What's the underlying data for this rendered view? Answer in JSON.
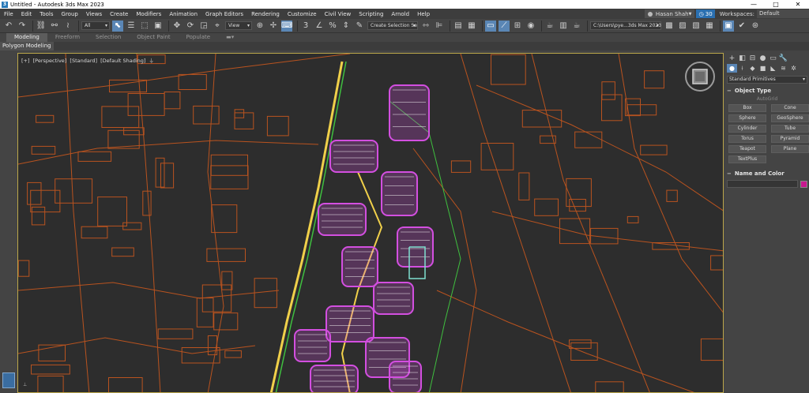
{
  "window": {
    "title": "Untitled - Autodesk 3ds Max 2023",
    "app_icon": "3",
    "controls": [
      "—",
      "□",
      "✕"
    ]
  },
  "menu": [
    "File",
    "Edit",
    "Tools",
    "Group",
    "Views",
    "Create",
    "Modifiers",
    "Animation",
    "Graph Editors",
    "Rendering",
    "Customize",
    "Civil View",
    "Scripting",
    "Arnold",
    "Help"
  ],
  "user": {
    "name": "Hasan Shah",
    "clock": "30"
  },
  "workspace": {
    "label": "Workspaces:",
    "value": "Default"
  },
  "toolbar": {
    "filter": "All",
    "coord": "View",
    "selection_set": "Create Selection Se",
    "project_path": "C:\\Users\\pye...3ds Max 2023"
  },
  "ribbon": {
    "tabs": [
      "Modeling",
      "Freeform",
      "Selection",
      "Object Paint",
      "Populate"
    ],
    "active": "Modeling",
    "panel_label": "Polygon Modeling"
  },
  "viewport": {
    "labels": [
      "[+]",
      "[Perspective]",
      "[Standard]",
      "[Default Shading]"
    ],
    "filter_icon": "funnel-icon"
  },
  "command_panel": {
    "primitive_type": "Standard Primitives",
    "object_type_title": "Object Type",
    "autogrid": "AutoGrid",
    "buttons": [
      "Box",
      "Cone",
      "Sphere",
      "GeoSphere",
      "Cylinder",
      "Tube",
      "Torus",
      "Pyramid",
      "Teapot",
      "Plane",
      "TextPlus"
    ],
    "name_color_title": "Name and Color",
    "color_swatch": "#c8178f"
  },
  "colors": {
    "accent": "#5a86b5",
    "viewport_border": "#bba74a",
    "roads": "#b9531f",
    "parcels": "#d34fe0",
    "green_lines": "#3fbf3f",
    "yellow_lines": "#f0d04a"
  }
}
